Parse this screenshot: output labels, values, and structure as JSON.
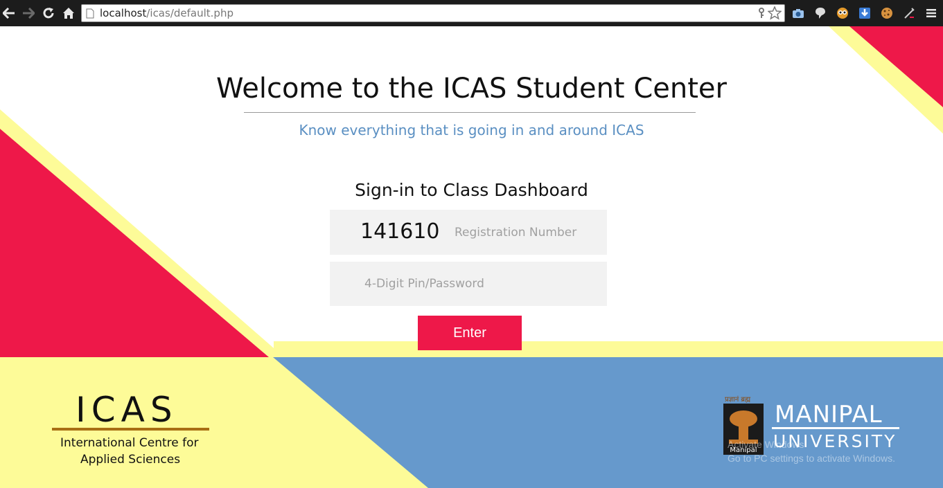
{
  "browser": {
    "url_host": "localhost",
    "url_path": "/icas/default.php"
  },
  "page": {
    "title": "Welcome to the ICAS Student Center",
    "subtitle": "Know everything that is going in and around ICAS",
    "signin_heading": "Sign-in to Class Dashboard",
    "registration": {
      "value": "141610",
      "placeholder": "Registration Number"
    },
    "pin": {
      "placeholder": "4-Digit Pin/Password"
    },
    "enter_label": "Enter"
  },
  "footer": {
    "icas_logo": {
      "word": "ICAS",
      "line1": "International Centre for",
      "line2": "Applied Sciences"
    },
    "manipal_logo": {
      "tagline": "प्रज्ञानं ब्रह्म",
      "word1": "MANIPAL",
      "word2": "UNIVERSITY"
    },
    "windows_watermark": {
      "line1": "Activate Windows",
      "line2": "Go to PC settings to activate Windows."
    }
  },
  "colors": {
    "crimson": "#ee1849",
    "yellow": "#fdfb98",
    "blue": "#6699cc",
    "chrome_bg": "#1c1c1c"
  }
}
